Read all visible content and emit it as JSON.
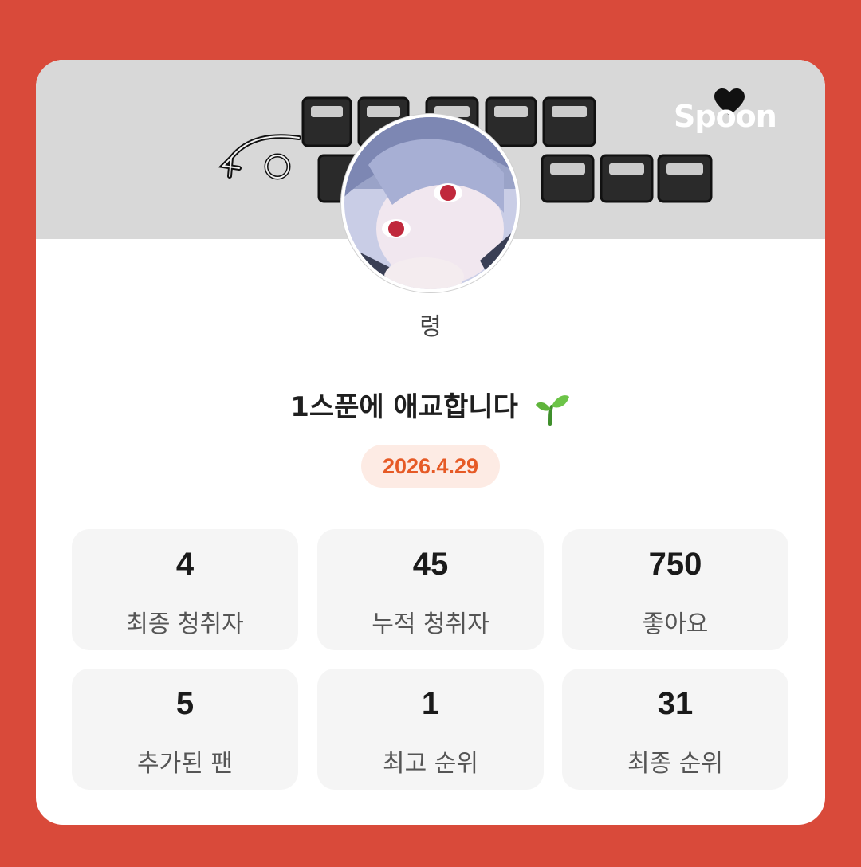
{
  "banner": {
    "brand": "Spoon"
  },
  "profile": {
    "nickname": "령"
  },
  "live": {
    "title": "1스푼에 애교합니다",
    "title_emoji": "sprout-icon",
    "date": "2026.4.29"
  },
  "stats": [
    {
      "value": "4",
      "label": "최종 청취자"
    },
    {
      "value": "45",
      "label": "누적 청취자"
    },
    {
      "value": "750",
      "label": "좋아요"
    },
    {
      "value": "5",
      "label": "추가된 팬"
    },
    {
      "value": "1",
      "label": "최고 순위"
    },
    {
      "value": "31",
      "label": "최종 순위"
    }
  ],
  "colors": {
    "background": "#d94a3a",
    "card": "#ffffff",
    "banner": "#d8d8d8",
    "date_text": "#e65a26",
    "date_pill": "#fdebe4",
    "stat_box": "#f5f5f5"
  }
}
